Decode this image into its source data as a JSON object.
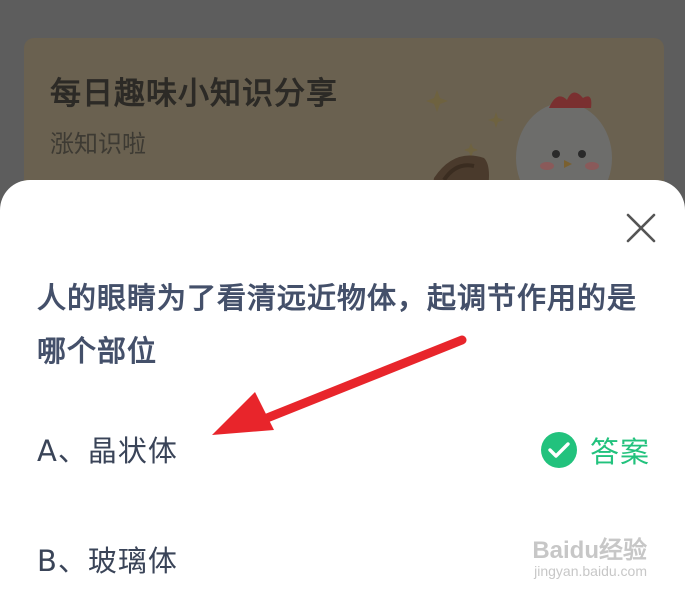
{
  "banner": {
    "title": "每日趣味小知识分享",
    "subtitle": "涨知识啦"
  },
  "dialog": {
    "question": "人的眼睛为了看清远近物体，起调节作用的是哪个部位",
    "close_icon": "close-icon",
    "options": [
      {
        "label": "A、晶状体"
      },
      {
        "label": "B、玻璃体"
      }
    ],
    "answer_label": "答案",
    "answer_icon": "check-circle-icon",
    "answer_color": "#22c27d"
  },
  "watermark": {
    "text": "Baidu经验",
    "url": "jingyan.baidu.com"
  }
}
